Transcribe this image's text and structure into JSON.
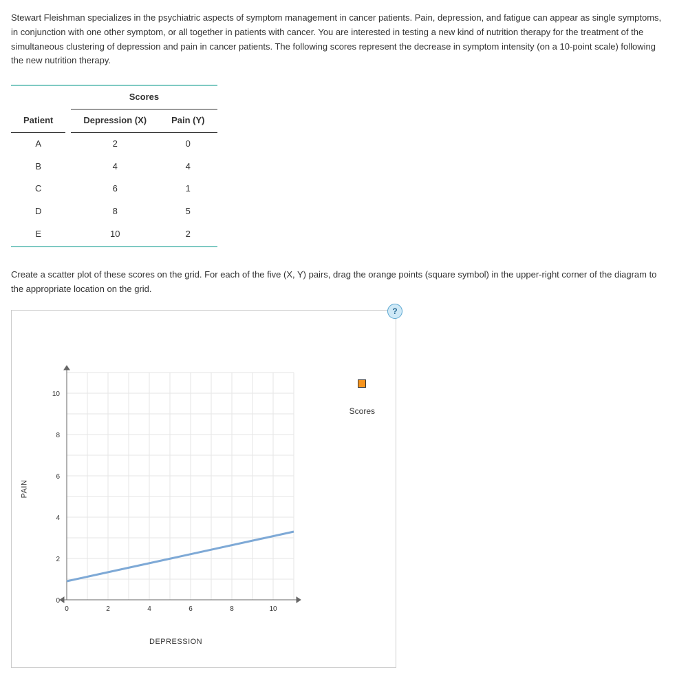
{
  "intro": "Stewart Fleishman specializes in the psychiatric aspects of symptom management in cancer patients. Pain, depression, and fatigue can appear as single symptoms, in conjunction with one other symptom, or all together in patients with cancer. You are interested in testing a new kind of nutrition therapy for the treatment of the simultaneous clustering of depression and pain in cancer patients. The following scores represent the decrease in symptom intensity (on a 10-point scale) following the new nutrition therapy.",
  "table": {
    "scores_header": "Scores",
    "col_patient": "Patient",
    "col_x": "Depression (X)",
    "col_y": "Pain (Y)",
    "rows": [
      {
        "patient": "A",
        "x": "2",
        "y": "0"
      },
      {
        "patient": "B",
        "x": "4",
        "y": "4"
      },
      {
        "patient": "C",
        "x": "6",
        "y": "1"
      },
      {
        "patient": "D",
        "x": "8",
        "y": "5"
      },
      {
        "patient": "E",
        "x": "10",
        "y": "2"
      }
    ]
  },
  "instruction": "Create a scatter plot of these scores on the grid. For each of the five (X, Y) pairs, drag the orange points (square symbol) in the upper-right corner of the diagram to the appropriate location on the grid.",
  "plot": {
    "help": "?",
    "y_label": "PAIN",
    "x_label": "DEPRESSION",
    "legend_label": "Scores",
    "x_ticks": [
      "0",
      "2",
      "4",
      "6",
      "8",
      "10"
    ],
    "y_ticks": [
      "0",
      "2",
      "4",
      "6",
      "8",
      "10"
    ]
  },
  "chart_data": {
    "type": "scatter",
    "title": "",
    "xlabel": "DEPRESSION",
    "ylabel": "PAIN",
    "xlim": [
      0,
      11
    ],
    "ylim": [
      0,
      11
    ],
    "series": [
      {
        "name": "Scores",
        "x": [
          2,
          4,
          6,
          8,
          10
        ],
        "y": [
          0,
          4,
          1,
          5,
          2
        ],
        "placed": false
      },
      {
        "name": "trendline",
        "type": "line",
        "x": [
          0,
          11
        ],
        "y": [
          0.9,
          3.3
        ]
      }
    ]
  }
}
